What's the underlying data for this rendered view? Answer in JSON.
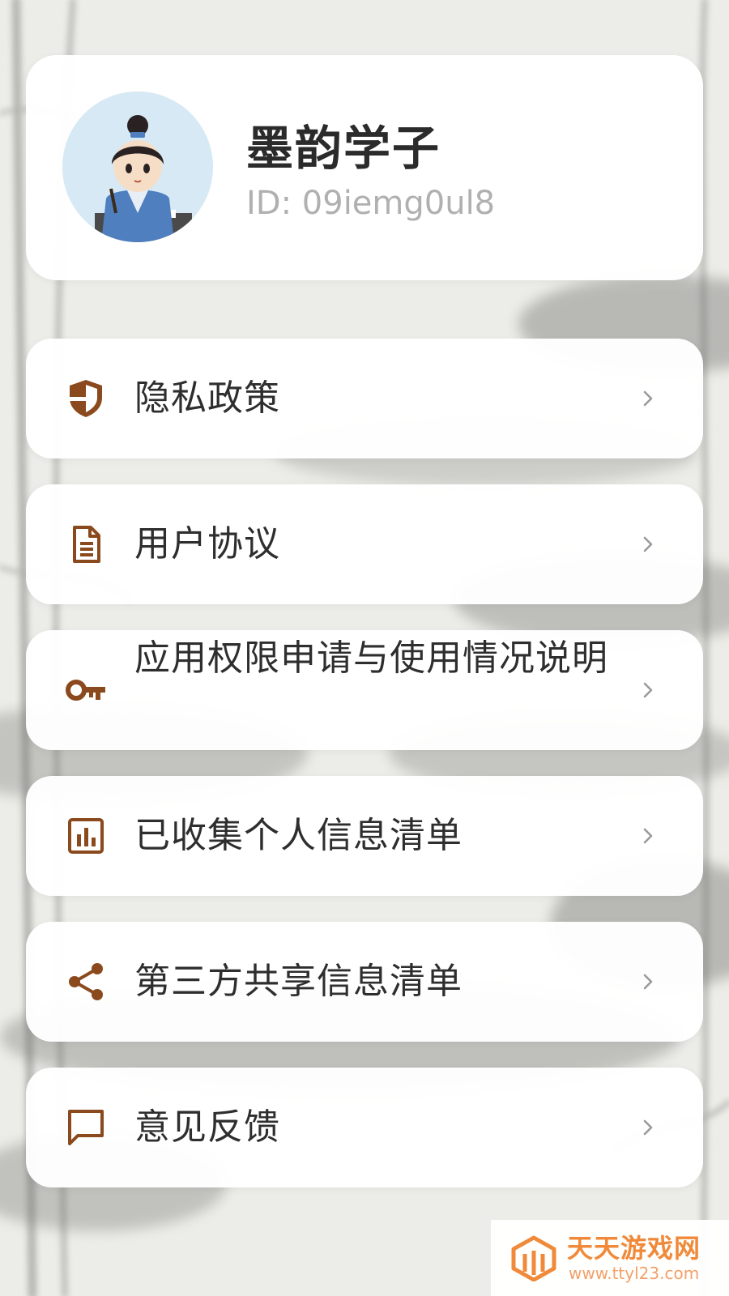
{
  "profile": {
    "username": "墨韵学子",
    "user_id": "ID: 09iemg0ul8"
  },
  "menu": [
    {
      "label": "隐私政策",
      "icon": "shield-icon"
    },
    {
      "label": "用户协议",
      "icon": "document-icon"
    },
    {
      "label": "应用权限申请与使用情况说明",
      "icon": "key-icon"
    },
    {
      "label": "已收集个人信息清单",
      "icon": "bar-chart-icon"
    },
    {
      "label": "第三方共享信息清单",
      "icon": "share-icon"
    },
    {
      "label": "意见反馈",
      "icon": "chat-bubble-icon"
    }
  ],
  "colors": {
    "accent": "#8b4a1e",
    "card_bg": "#ffffff",
    "text_primary": "#2e2e2e",
    "text_secondary": "#b0b0b0",
    "chevron": "#9a9a9a",
    "watermark": "#f08a3a"
  },
  "watermark": {
    "title": "天天游戏网",
    "url": "www.ttyl23.com"
  }
}
